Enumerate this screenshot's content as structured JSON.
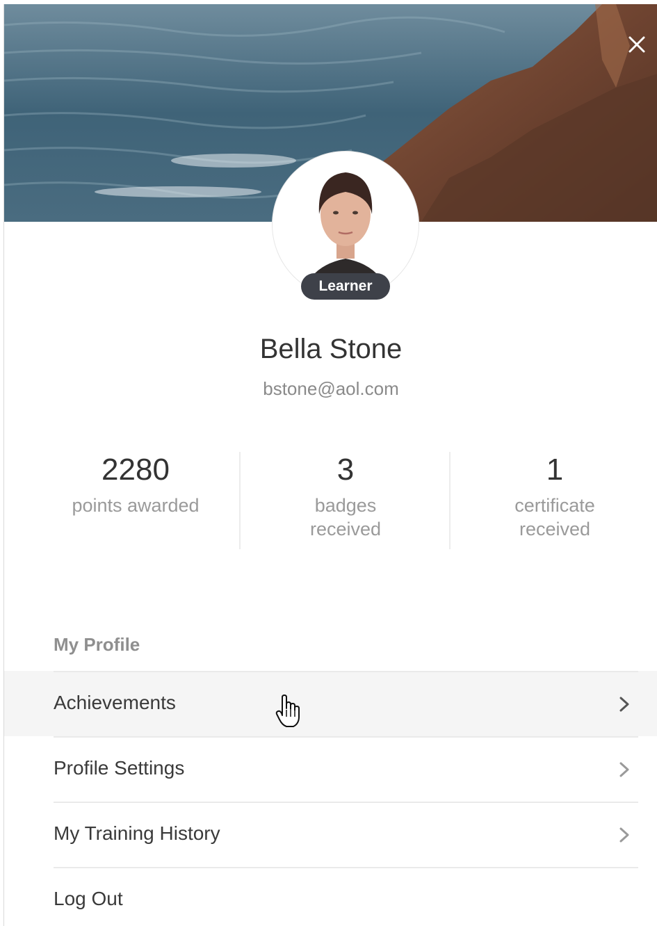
{
  "profile": {
    "role_badge": "Learner",
    "name": "Bella Stone",
    "email": "bstone@aol.com"
  },
  "stats": [
    {
      "value": "2280",
      "label": "points awarded"
    },
    {
      "value": "3",
      "label_line1": "badges",
      "label_line2": "received"
    },
    {
      "value": "1",
      "label_line1": "certificate",
      "label_line2": "received"
    }
  ],
  "section": {
    "title": "My Profile"
  },
  "menu": {
    "items": [
      {
        "label": "Achievements",
        "hovered": true
      },
      {
        "label": "Profile Settings"
      },
      {
        "label": "My Training History"
      },
      {
        "label": "Log Out"
      }
    ]
  },
  "icons": {
    "close": "close-icon",
    "chevron": "chevron-right-icon",
    "cursor": "hand-pointer-icon"
  },
  "colors": {
    "badge_bg": "#3e4149",
    "hover_bg": "#f5f5f5",
    "muted_text": "#8a8a8a"
  }
}
